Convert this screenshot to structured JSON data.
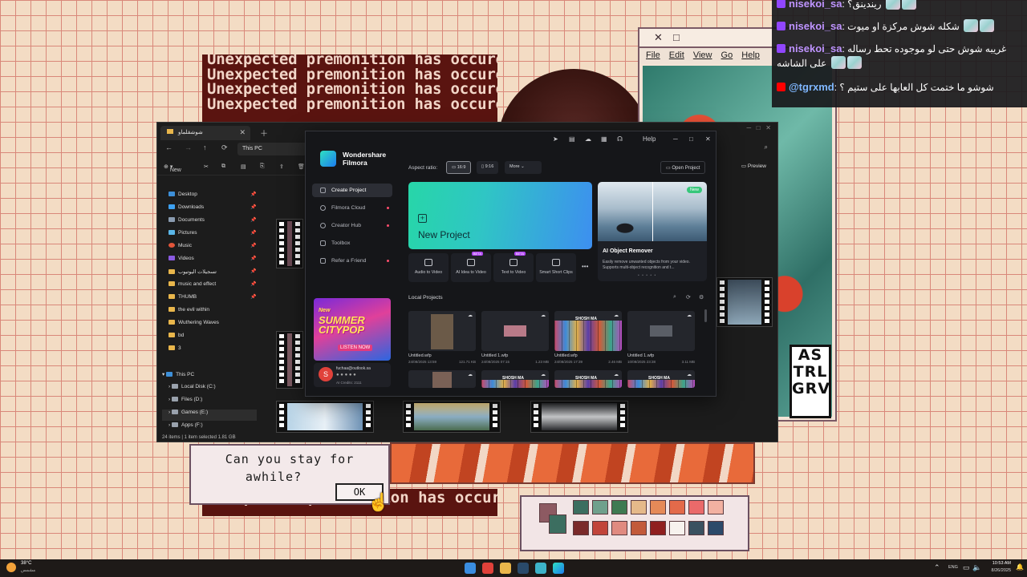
{
  "wallpaper": {
    "premonition_line": "Unexpected premonition has occured",
    "dialog_text_1": "Can you stay for",
    "dialog_text_2": "awhile?",
    "dialog_ok": "OK",
    "art_menu": [
      "File",
      "Edit",
      "View",
      "Go",
      "Help"
    ],
    "art_logo_lines": [
      "AS",
      "TRL",
      "GRV"
    ]
  },
  "explorer": {
    "tab_title": "شوشقلماو",
    "address_this_pc": "This PC",
    "toolbar_new": "New",
    "preview_label": "Preview",
    "nav_items": [
      {
        "label": "Desktop",
        "color": "#3d8fd8",
        "pinned": true
      },
      {
        "label": "Downloads",
        "color": "#3da0f0",
        "pinned": true
      },
      {
        "label": "Documents",
        "color": "#8a9bb0",
        "pinned": true
      },
      {
        "label": "Pictures",
        "color": "#5ab6e8",
        "pinned": true
      },
      {
        "label": "Music",
        "color": "#e2553a",
        "pinned": true
      },
      {
        "label": "Videos",
        "color": "#8a5ae0",
        "pinned": true
      },
      {
        "label": "تسجيلات اليوتيوب",
        "color": "#e9b64b",
        "pinned": true
      },
      {
        "label": "music and effect",
        "color": "#e9b64b",
        "pinned": true
      },
      {
        "label": "THUMB",
        "color": "#e9b64b",
        "pinned": true
      },
      {
        "label": "the evil within",
        "color": "#e9b64b",
        "pinned": false
      },
      {
        "label": "Wuthering Waves",
        "color": "#e9b64b",
        "pinned": false
      },
      {
        "label": "bd",
        "color": "#e9b64b",
        "pinned": false
      },
      {
        "label": "3",
        "color": "#e9b64b",
        "pinned": false
      }
    ],
    "this_pc": "This PC",
    "drives": [
      "Local Disk (C:)",
      "Files (D:)",
      "Games (E:)",
      "Apps (F:)"
    ],
    "status": "24 items  |  1 item selected  1.81 GB"
  },
  "filmora": {
    "help": "Help",
    "brand_line1": "Wondershare",
    "brand_line2": "Filmora",
    "sidebar": [
      {
        "label": "Create Project",
        "active": true,
        "dot": false
      },
      {
        "label": "Filmora Cloud",
        "active": false,
        "dot": true
      },
      {
        "label": "Creator Hub",
        "active": false,
        "dot": true
      },
      {
        "label": "Toolbox",
        "active": false,
        "dot": false
      },
      {
        "label": "Refer a Friend",
        "active": false,
        "dot": true
      }
    ],
    "promo": {
      "line1": "New",
      "line2": "SUMMER",
      "line3": "CITYPOP",
      "cta": "LISTEN NOW"
    },
    "user_email": "fuchaa@outlook.sa",
    "user_initial": "S",
    "user_credits": "AI Credits: 2111",
    "aspect_label": "Aspect ratio:",
    "aspect_options": [
      "16:9",
      "9:16",
      "More"
    ],
    "open_project": "Open Project",
    "new_project": "New Project",
    "tools": [
      {
        "label": "Audio to Video",
        "beta": ""
      },
      {
        "label": "AI Idea to Video",
        "beta": "BETA"
      },
      {
        "label": "Text to Video",
        "beta": "BETA"
      },
      {
        "label": "Smart Short Clips",
        "beta": ""
      }
    ],
    "feature": {
      "badge": "New",
      "title": "AI Object Remover",
      "desc": "Easily remove unwanted objects from your video. Supports multi-object recognition and t..."
    },
    "local_projects": "Local Projects",
    "projects": [
      {
        "name": "Untitled.wfp",
        "date": "24/08/2025 13:59",
        "size": "121.71 KB",
        "shosh": ""
      },
      {
        "name": "Untitled 1.wfp",
        "date": "24/08/2025 07:15",
        "size": "1.23 MB",
        "shosh": ""
      },
      {
        "name": "Untitled.wfp",
        "date": "24/08/2025 17:39",
        "size": "2.46 MB",
        "shosh": "SHOSH MA"
      },
      {
        "name": "Untitled 1.wfp",
        "date": "10/08/2025 23:38",
        "size": "3.11 MB",
        "shosh": ""
      }
    ],
    "projects_row2": [
      "",
      "SHOSH MA",
      "SHOSH MA",
      "SHOSH MA"
    ]
  },
  "chat": [
    {
      "platform": "twitch",
      "user": "nisekoi_sa",
      "text": "ريندينق؟",
      "emotes": 2
    },
    {
      "platform": "twitch",
      "user": "nisekoi_sa",
      "text": "شكله شوش مركزة او ميوت",
      "emotes": 2
    },
    {
      "platform": "twitch",
      "user": "nisekoi_sa",
      "text": "غريبه شوش حتى لو موجوده تحط رساله على الشاشه",
      "emotes": 2
    },
    {
      "platform": "youtube",
      "user": "@tgrxmd",
      "text": "شوشو ما ختمت كل العابها على ستيم ؟",
      "emotes": 0
    }
  ],
  "taskbar": {
    "temp": "38°C",
    "condition": "مشمس",
    "lang": "ENG",
    "time": "10:53 AM",
    "date": "8/26/2025"
  }
}
